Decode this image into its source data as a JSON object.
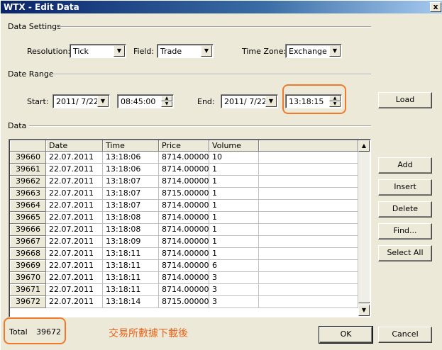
{
  "window": {
    "title": "WTX - Edit Data",
    "close_glyph": "x"
  },
  "data_settings": {
    "group_label": "Data Settings",
    "resolution": {
      "label": "Resolution:",
      "value": "Tick"
    },
    "field": {
      "label": "Field:",
      "value": "Trade"
    },
    "time_zone": {
      "label": "Time Zone:",
      "value": "Exchange"
    }
  },
  "date_range": {
    "group_label": "Date Range",
    "start": {
      "label": "Start:",
      "date": "2011/ 7/22",
      "time": "08:45:00"
    },
    "end": {
      "label": "End:",
      "date": "2011/ 7/22",
      "time": "13:18:15"
    },
    "load_label": "Load"
  },
  "data_section": {
    "group_label": "Data",
    "columns": [
      "",
      "Date",
      "Time",
      "Price",
      "Volume"
    ],
    "rows": [
      [
        "39660",
        "22.07.2011",
        "13:18:06",
        "8714.00000",
        "10"
      ],
      [
        "39661",
        "22.07.2011",
        "13:18:06",
        "8714.00000",
        "1"
      ],
      [
        "39662",
        "22.07.2011",
        "13:18:07",
        "8714.00000",
        "1"
      ],
      [
        "39663",
        "22.07.2011",
        "13:18:07",
        "8715.00000",
        "1"
      ],
      [
        "39664",
        "22.07.2011",
        "13:18:07",
        "8714.00000",
        "1"
      ],
      [
        "39665",
        "22.07.2011",
        "13:18:08",
        "8714.00000",
        "1"
      ],
      [
        "39666",
        "22.07.2011",
        "13:18:08",
        "8714.00000",
        "1"
      ],
      [
        "39667",
        "22.07.2011",
        "13:18:09",
        "8714.00000",
        "1"
      ],
      [
        "39668",
        "22.07.2011",
        "13:18:11",
        "8714.00000",
        "1"
      ],
      [
        "39669",
        "22.07.2011",
        "13:18:11",
        "8714.00000",
        "6"
      ],
      [
        "39670",
        "22.07.2011",
        "13:18:11",
        "8714.00000",
        "3"
      ],
      [
        "39671",
        "22.07.2011",
        "13:18:11",
        "8714.00000",
        "3"
      ],
      [
        "39672",
        "22.07.2011",
        "13:18:14",
        "8715.00000",
        "3"
      ]
    ]
  },
  "side_buttons": {
    "add": "Add",
    "insert": "Insert",
    "delete": "Delete",
    "find": "Find...",
    "select_all": "Select All"
  },
  "footer": {
    "total_label": "Total",
    "total_value": "39672",
    "annotation": "交易所數據下載後",
    "ok_label": "OK",
    "cancel_label": "Cancel"
  },
  "colors": {
    "highlight": "#f07a2a",
    "annotation_text": "#e8641a"
  }
}
